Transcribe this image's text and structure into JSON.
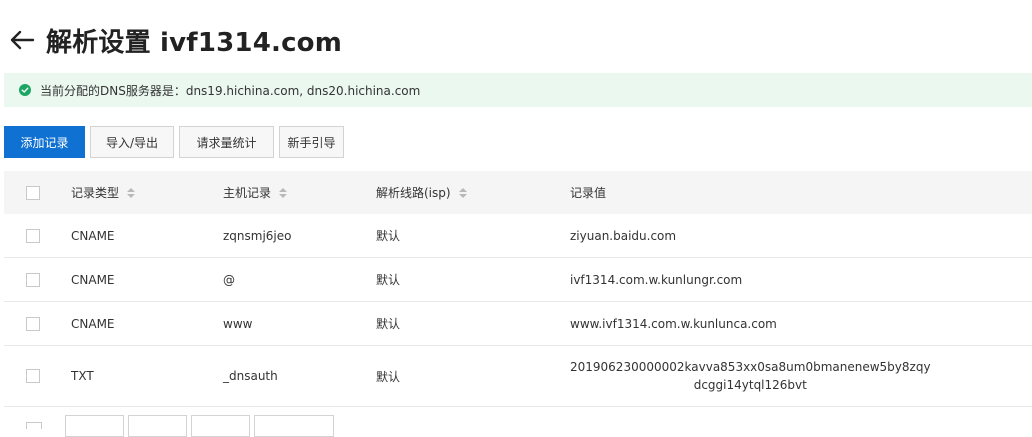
{
  "header": {
    "title": "解析设置 ivf1314.com",
    "back_icon": "arrow-left-icon"
  },
  "notice": {
    "icon": "check-circle-icon",
    "text": "当前分配的DNS服务器是：dns19.hichina.com, dns20.hichina.com",
    "icon_color": "#1ca664",
    "background": "#ebf8f0"
  },
  "toolbar": {
    "add_record": "添加记录",
    "import_export": "导入/导出",
    "request_stats": "请求量统计",
    "beginner_guide": "新手引导",
    "primary_color": "#0f71d1"
  },
  "table": {
    "columns": {
      "record_type": "记录类型",
      "host_record": "主机记录",
      "line": "解析线路(isp)",
      "value": "记录值"
    },
    "rows": [
      {
        "type": "CNAME",
        "host": "zqnsmj6jeo",
        "line": "默认",
        "value": "ziyuan.baidu.com",
        "value2": ""
      },
      {
        "type": "CNAME",
        "host": "@",
        "line": "默认",
        "value": "ivf1314.com.w.kunlungr.com",
        "value2": ""
      },
      {
        "type": "CNAME",
        "host": "www",
        "line": "默认",
        "value": "www.ivf1314.com.w.kunlunca.com",
        "value2": ""
      },
      {
        "type": "TXT",
        "host": "_dnsauth",
        "line": "默认",
        "value": "201906230000002kavva853xx0sa8um0bmanenew5by8zqy",
        "value2": "dcggi14ytql126bvt"
      }
    ]
  }
}
